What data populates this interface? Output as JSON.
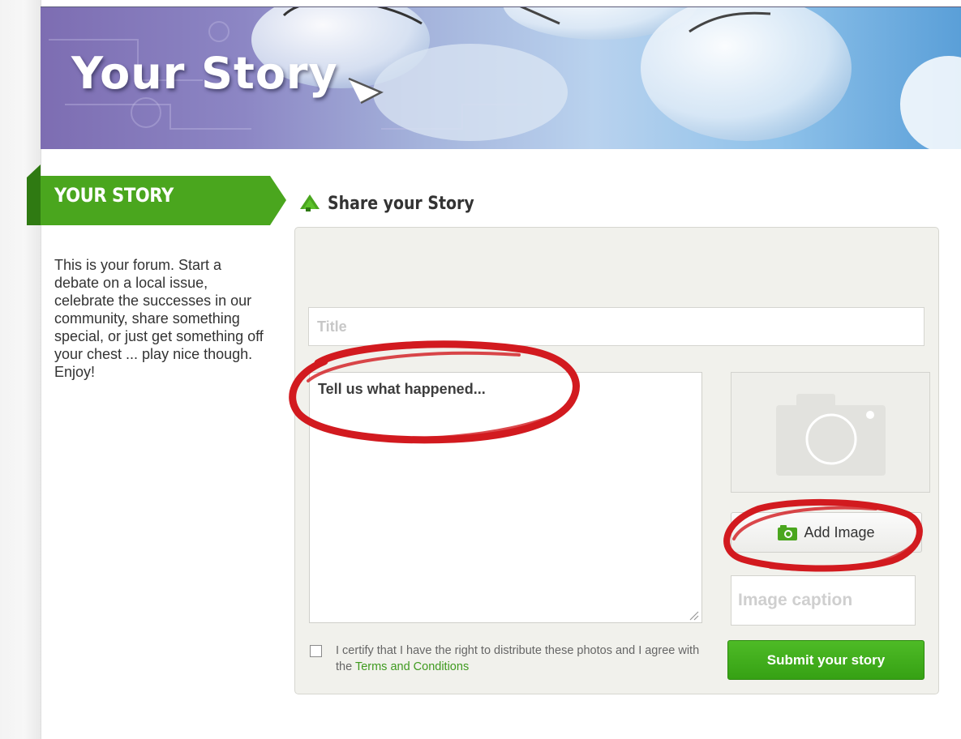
{
  "banner": {
    "title": "Your Story"
  },
  "sidebar": {
    "heading": "YOUR STORY",
    "description": "This is your forum. Start a debate on a local issue, celebrate the successes in our community, share something special, or just get something off your chest ... play nice though. Enjoy!"
  },
  "main": {
    "section_title": "Share your Story",
    "title_placeholder": "Title",
    "story_placeholder": "Tell us what happened...",
    "add_image_label": "Add Image",
    "caption_placeholder": "Image caption",
    "certify_text": "I certify that I have the right to distribute these photos and I agree with the",
    "terms_link": "Terms and Conditions",
    "submit_label": "Submit your story"
  },
  "colors": {
    "accent_green": "#4aa61e",
    "annotation_red": "#d21a1f"
  },
  "icons": [
    "megaphone-icon",
    "camera-icon",
    "camera-placeholder-icon"
  ]
}
